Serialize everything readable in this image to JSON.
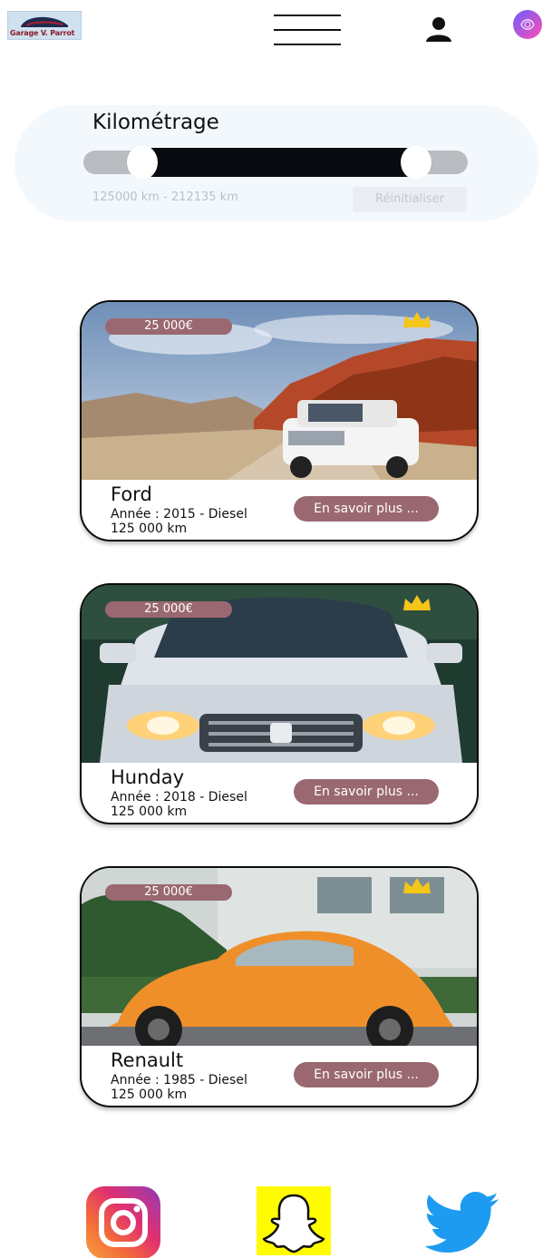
{
  "header": {
    "logo_text": "Garage V. Parrot",
    "menu_icon": "hamburger-icon",
    "user_icon": "user-icon",
    "avatar_icon": "avatar-icon"
  },
  "filter": {
    "title": "Kilométrage",
    "range_text": "125000 km - 212135  km",
    "reset_label": "Réinitialiser",
    "min_value": 125000,
    "max_value": 212135
  },
  "cars": [
    {
      "price": "25 000€",
      "name": "Ford",
      "year_fuel": "Année : 2015 - Diesel",
      "mileage": "125 000 km",
      "more_label": "En savoir plus ...",
      "favorite_icon": "crown-icon"
    },
    {
      "price": "25 000€",
      "name": "Hunday",
      "year_fuel": "Année : 2018 - Diesel",
      "mileage": "125 000 km",
      "more_label": "En savoir plus ...",
      "favorite_icon": "crown-icon"
    },
    {
      "price": "25 000€",
      "name": "Renault",
      "year_fuel": "Année : 1985 - Diesel",
      "mileage": "125 000 km",
      "more_label": "En savoir plus ...",
      "favorite_icon": "crown-icon"
    }
  ],
  "social": {
    "items": [
      "instagram-icon",
      "snapchat-icon",
      "twitter-icon"
    ]
  },
  "colors": {
    "accent": "#9a6870",
    "favorite": "#f5c518",
    "slider_fill": "#070a0f",
    "filter_bg": "#f3f8fd"
  }
}
